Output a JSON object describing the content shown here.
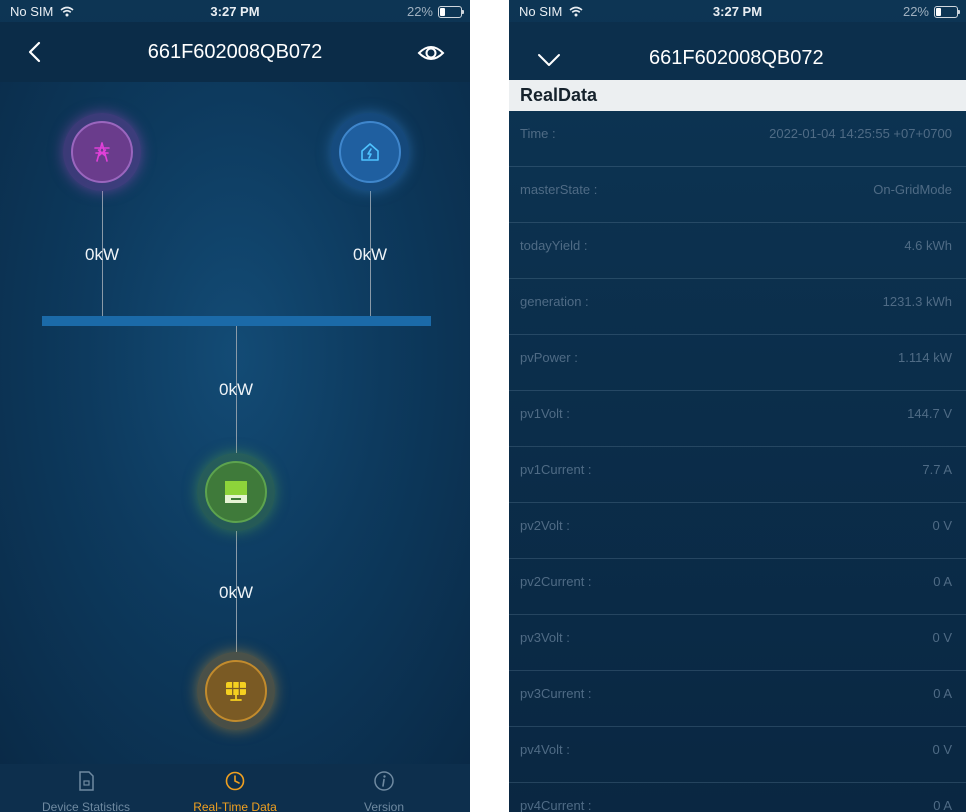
{
  "left": {
    "status": {
      "carrier": "No SIM",
      "time": "3:27 PM",
      "battery": "22%"
    },
    "nav": {
      "title": "661F602008QB072"
    },
    "flow": {
      "grid_power": "0kW",
      "home_power": "0kW",
      "inverter_power": "0kW",
      "solar_power": "0kW"
    },
    "tabs": [
      {
        "label": "Device Statistics",
        "icon": "document-icon"
      },
      {
        "label": "Real-Time Data",
        "icon": "clock-chart-icon"
      },
      {
        "label": "Version",
        "icon": "info-icon"
      }
    ],
    "colors": {
      "accent": "#f0a020",
      "bus": "#1b6aa8",
      "grid": "#e040d8",
      "home": "#4fc3ff",
      "inverter": "#8ed43a",
      "solar": "#f5d020"
    }
  },
  "right": {
    "status": {
      "carrier": "No SIM",
      "time": "3:27 PM",
      "battery": "22%"
    },
    "nav": {
      "title": "661F602008QB072"
    },
    "section": "RealData",
    "rows": [
      {
        "key": "Time :",
        "value": "2022-01-04 14:25:55 +07+0700"
      },
      {
        "key": "masterState :",
        "value": "On-GridMode"
      },
      {
        "key": "todayYield :",
        "value": "4.6 kWh"
      },
      {
        "key": "generation :",
        "value": "1231.3 kWh"
      },
      {
        "key": "pvPower :",
        "value": "1.114 kW"
      },
      {
        "key": "pv1Volt :",
        "value": "144.7 V"
      },
      {
        "key": "pv1Current :",
        "value": "7.7 A"
      },
      {
        "key": "pv2Volt :",
        "value": "0 V"
      },
      {
        "key": "pv2Current :",
        "value": "0 A"
      },
      {
        "key": "pv3Volt :",
        "value": "0 V"
      },
      {
        "key": "pv3Current :",
        "value": "0 A"
      },
      {
        "key": "pv4Volt :",
        "value": "0 V"
      },
      {
        "key": "pv4Current :",
        "value": "0 A"
      }
    ]
  }
}
